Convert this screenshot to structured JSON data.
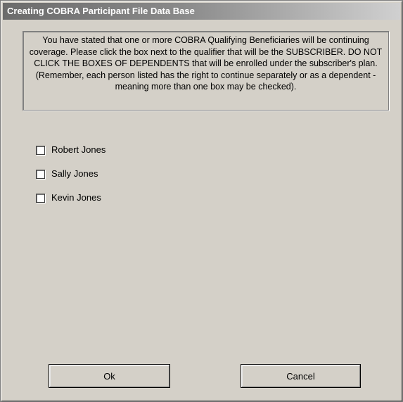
{
  "window": {
    "title": "Creating COBRA Participant File Data Base"
  },
  "message": {
    "text": "You have stated that one or more COBRA Qualifying Beneficiaries will be continuing coverage.  Please click the box next to the qualifier that will be the SUBSCRIBER.  DO NOT CLICK THE BOXES OF DEPENDENTS that will be enrolled under the subscriber's plan.  (Remember, each person listed has the right to continue separately or as a dependent - meaning more than one box may be checked)."
  },
  "participants": [
    {
      "name": "Robert Jones",
      "checked": false
    },
    {
      "name": "Sally Jones",
      "checked": false
    },
    {
      "name": "Kevin Jones",
      "checked": false
    }
  ],
  "buttons": {
    "ok_label": "Ok",
    "cancel_label": "Cancel"
  }
}
